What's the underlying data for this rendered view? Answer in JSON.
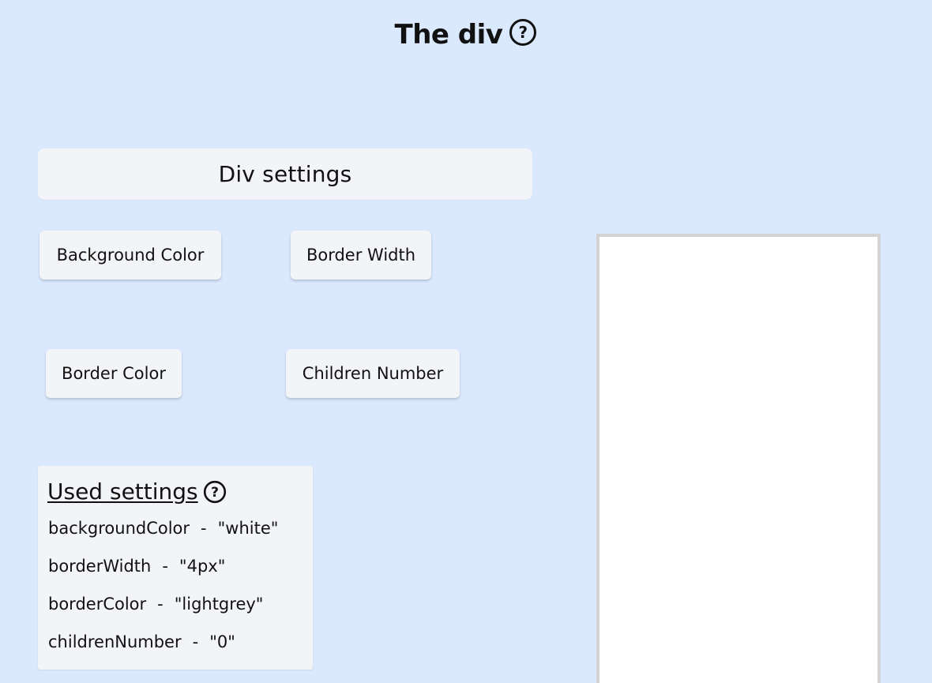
{
  "header": {
    "title": "The div",
    "help_icon": "question-circle-icon"
  },
  "settings": {
    "title": "Div settings",
    "buttons": [
      {
        "label": "Background Color"
      },
      {
        "label": "Border Width"
      },
      {
        "label": "Border Color"
      },
      {
        "label": "Children Number"
      }
    ]
  },
  "used_settings": {
    "title": "Used settings",
    "help_icon": "question-circle-icon",
    "separator": "-",
    "rows": [
      {
        "key": "backgroundColor",
        "value": "\"white\""
      },
      {
        "key": "borderWidth",
        "value": "\"4px\""
      },
      {
        "key": "borderColor",
        "value": "\"lightgrey\""
      },
      {
        "key": "childrenNumber",
        "value": "\"0\""
      }
    ]
  },
  "preview": {
    "background_color": "#ffffff",
    "border_color": "#d3d3d3",
    "children_number": 0
  },
  "colors": {
    "page_background": "#dbe9fe",
    "panel_background": "#f2f4f7"
  }
}
